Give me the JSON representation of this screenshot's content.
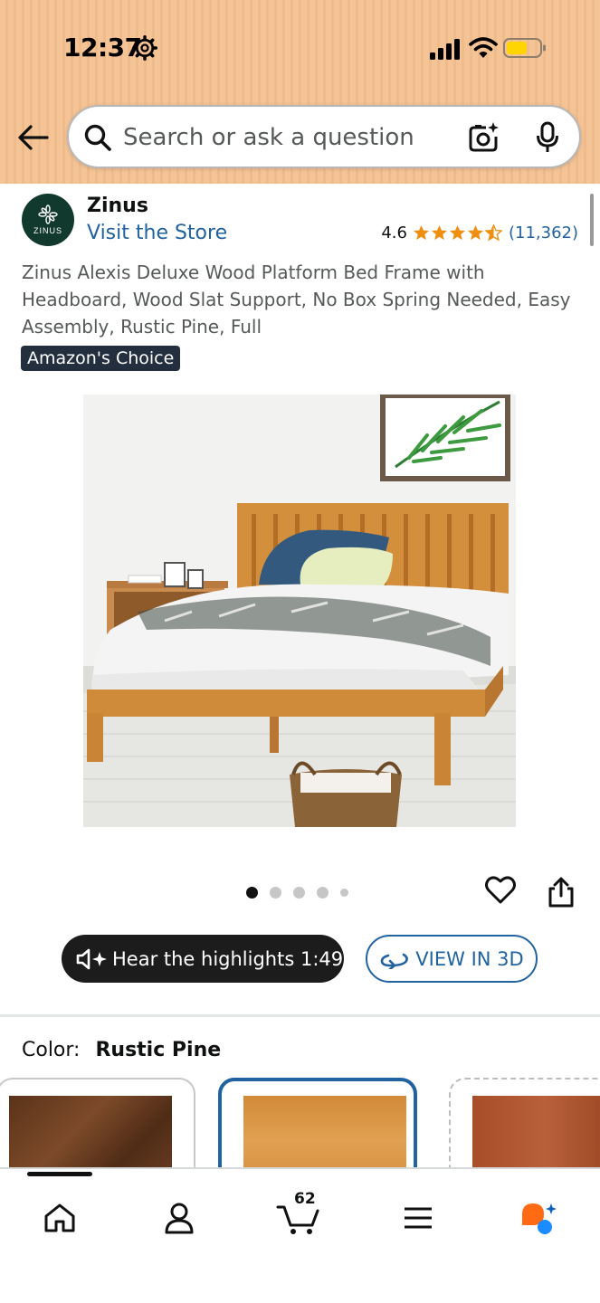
{
  "status_bar": {
    "time": "12:37"
  },
  "search": {
    "placeholder": "Search or ask a question"
  },
  "brand": {
    "logo_text": "ZINUS",
    "name": "Zinus",
    "visit_store": "Visit the Store"
  },
  "rating": {
    "value": "4.6",
    "stars": 4.5,
    "count": "(11,362)"
  },
  "product": {
    "title": "Zinus Alexis Deluxe Wood Platform Bed Frame with Headboard, Wood Slat Support, No Box Spring Needed, Easy Assembly, Rustic Pine, Full",
    "badge": "Amazon's Choice",
    "image_count": 5,
    "active_image": 1
  },
  "actions": {
    "highlights_label": "Hear the highlights 1:49",
    "view3d_label": "VIEW IN 3D"
  },
  "color": {
    "label": "Color:",
    "selected": "Rustic Pine",
    "swatches": [
      {
        "name": "dark-walnut",
        "color": "#6b3d22"
      },
      {
        "name": "rustic-pine",
        "color": "#d58f3c"
      },
      {
        "name": "brown",
        "color": "#a8502a"
      }
    ]
  },
  "nav": {
    "cart_count": "62"
  },
  "colors": {
    "accent": "#2162a1",
    "header_bg": "#f4c497",
    "star": "#f08f0f",
    "badge_bg": "#232f3e"
  }
}
